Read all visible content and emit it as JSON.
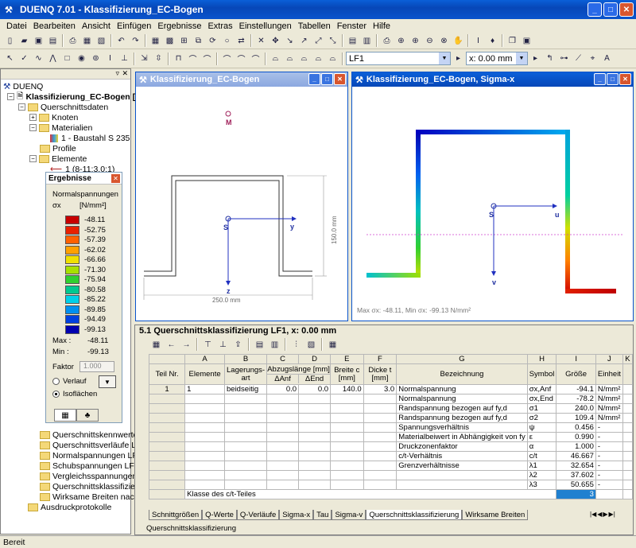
{
  "app": {
    "title": "DUENQ 7.01 - Klassifizierung_EC-Bogen"
  },
  "menu": [
    "Datei",
    "Bearbeiten",
    "Ansicht",
    "Einfügen",
    "Ergebnisse",
    "Extras",
    "Einstellungen",
    "Tabellen",
    "Fenster",
    "Hilfe"
  ],
  "toolbar": {
    "loadcase": "LF1",
    "position": "x: 0.00 mm"
  },
  "tree": [
    {
      "label": "DUENQ",
      "level": 0,
      "icon": "app-icon"
    },
    {
      "label": "Klassifizierung_EC-Bogen [De",
      "level": 1,
      "bold": true,
      "icon": "document-icon"
    },
    {
      "label": "Querschnittsdaten",
      "level": 2,
      "icon": "folder-icon"
    },
    {
      "label": "Knoten",
      "level": 3,
      "icon": "folder-icon"
    },
    {
      "label": "Materialien",
      "level": 3,
      "icon": "folder-icon"
    },
    {
      "label": "1 - Baustahl S 235",
      "level": 4,
      "icon": "material-icon"
    },
    {
      "label": "Profile",
      "level": 3,
      "icon": "folder-icon"
    },
    {
      "label": "Elemente",
      "level": 3,
      "icon": "folder-icon"
    },
    {
      "label": "1 (8-11;3.0;1)",
      "level": 4,
      "icon": "element-icon"
    }
  ],
  "tree_lower": [
    "Querschnittskennwerte LF",
    "Querschnittsverläufe LF1",
    "Normalspannungen LF1, x",
    "Schubspannungen LF1, x",
    "Vergleichsspannungen LF",
    "Querschnittsklassifizierun",
    "Wirksame Breiten nach EN",
    "Ausdruckprotokolle"
  ],
  "ergebnisse": {
    "title": "Ergebnisse",
    "heading": "Normalspannungen",
    "symbol": "σx",
    "unit": "[N/mm²]",
    "legend": [
      {
        "v": "-48.11",
        "c": "#C80000"
      },
      {
        "v": "-52.75",
        "c": "#E82000"
      },
      {
        "v": "-57.39",
        "c": "#FF6000"
      },
      {
        "v": "-62.02",
        "c": "#FFA000"
      },
      {
        "v": "-66.66",
        "c": "#F0E000"
      },
      {
        "v": "-71.30",
        "c": "#A8E000"
      },
      {
        "v": "-75.94",
        "c": "#30D030"
      },
      {
        "v": "-80.58",
        "c": "#00C890"
      },
      {
        "v": "-85.22",
        "c": "#00D0E8"
      },
      {
        "v": "-89.85",
        "c": "#0090F0"
      },
      {
        "v": "-94.49",
        "c": "#0040E0"
      },
      {
        "v": "-99.13",
        "c": "#0000B0"
      }
    ],
    "max_label": "Max :",
    "max": "-48.11",
    "min_label": "Min :",
    "min": "-99.13",
    "faktor_label": "Faktor",
    "faktor": "1.000",
    "opt1": "Verlauf",
    "opt2": "Isoflächen"
  },
  "win1": {
    "title": "Klassifizierung_EC-Bogen",
    "dim_width": "250.0 mm",
    "dim_height": "150.0 mm",
    "labels": {
      "M": "M",
      "S": "S",
      "y": "y",
      "z": "z"
    }
  },
  "win2": {
    "title": "Klassifizierung_EC-Bogen, Sigma-x",
    "status": "Max σx: -48.11, Min σx: -99.13 N/mm²",
    "labels": {
      "S": "S",
      "u": "u",
      "v": "v"
    }
  },
  "table": {
    "title": "5.1 Querschnittsklassifizierung LF1, x: 0.00 mm",
    "cols": [
      "A",
      "B",
      "C",
      "D",
      "E",
      "F",
      "G",
      "H",
      "I",
      "J",
      "K"
    ],
    "head1": [
      "Teil Nr.",
      "Elemente",
      "Lagerungs-art",
      "Abzugslänge [mm]",
      "",
      "Breite c [mm]",
      "Dicke t [mm]",
      "Bezeichnung",
      "Symbol",
      "Größe",
      "Einheit"
    ],
    "head2": [
      "ΔAnf",
      "ΔEnd"
    ],
    "row": [
      "1",
      "1",
      "beidseitig",
      "0.0",
      "0.0",
      "140.0",
      "3.0"
    ],
    "rows": [
      [
        "Normalspannung",
        "σx,Anf",
        "-94.1",
        "N/mm²"
      ],
      [
        "Normalspannung",
        "σx,End",
        "-78.2",
        "N/mm²"
      ],
      [
        "Randspannung bezogen auf fy,d",
        "σ1",
        "240.0",
        "N/mm²"
      ],
      [
        "Randspannung bezogen auf fy,d",
        "σ2",
        "109.4",
        "N/mm²"
      ],
      [
        "Spannungsverhältnis",
        "ψ",
        "0.456",
        "-"
      ],
      [
        "Materialbeiwert in Abhängigkeit von fy",
        "ε",
        "0.990",
        "-"
      ],
      [
        "Druckzonenfaktor",
        "α",
        "1.000",
        "-"
      ],
      [
        "c/t-Verhältnis",
        "c/t",
        "46.667",
        "-"
      ],
      [
        "Grenzverhältnisse",
        "λ1",
        "32.654",
        "-"
      ],
      [
        "",
        "λ2",
        "37.602",
        "-"
      ],
      [
        "",
        "λ3",
        "50.655",
        "-"
      ]
    ],
    "klasse_label": "Klasse des c/t-Teiles",
    "klasse": "3"
  },
  "tabs": [
    "Schnittgrößen",
    "Q-Werte",
    "Q-Verläufe",
    "Sigma-x",
    "Tau",
    "Sigma-v",
    "Querschnittsklassifizierung",
    "Wirksame Breiten"
  ],
  "panel_caption": "Querschnittsklassifizierung",
  "status": "Bereit"
}
